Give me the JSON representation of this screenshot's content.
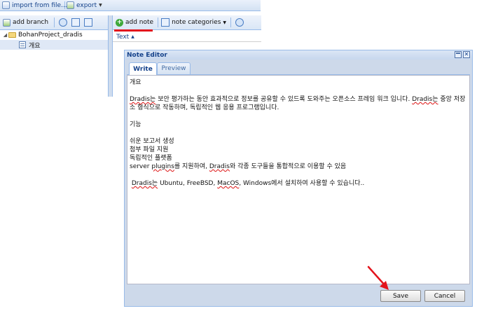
{
  "toolbar": {
    "import_label": "import from file...",
    "export_label": "export"
  },
  "tree_toolbar": {
    "add_branch_label": "add branch"
  },
  "tree": {
    "root_label": "BohanProject_dradis",
    "child_label": "개요"
  },
  "notes_toolbar": {
    "add_note_label": "add note",
    "note_categories_label": "note categories"
  },
  "notes_grid": {
    "column_header": "Text"
  },
  "note_editor": {
    "title": "Note Editor",
    "tabs": [
      "Write",
      "Preview"
    ],
    "active_tab": "Write",
    "content": {
      "heading": "개요",
      "para1_words": [
        "Dradis는",
        "보안 평가하는 동안 효과적으로 정보를 공유할 수 있드록 도와주는 오픈소스 프레임 워크 입니다.",
        "Dradis는",
        "중앙 저장소 형식으로 작동하며, 독립적인 웹 응용 프로그램입니다."
      ],
      "features_heading": "기능",
      "features": [
        "쉬운 보고서 생성",
        "첨부 파일 지원",
        "독립적인 플랫폼"
      ],
      "plugin_line_parts": [
        "server ",
        "plugins",
        "를 지원하여, ",
        "Dradis",
        "와 각종 도구들을 통합적으로 이용할 수 있음"
      ],
      "install_line_parts": [
        " ",
        "Dradis는",
        " Ubuntu, FreeBSD, ",
        "MacOS",
        ", Windows에서 설치하여 사용할 수 있습니다.."
      ]
    },
    "save_label": "Save",
    "cancel_label": "Cancel"
  },
  "colors": {
    "accent": "#15428b",
    "annotation": "#e3141d"
  }
}
